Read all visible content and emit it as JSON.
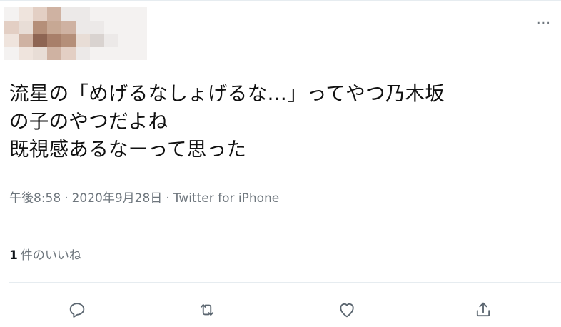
{
  "header": {
    "more_label": "···"
  },
  "tweet": {
    "text": "流星の「めげるなしょげるな…」ってやつ乃木坂\nの子のやつだよね\n既視感あるなーって思った",
    "time": "午後8:58",
    "separator": "·",
    "date": "2020年9月28日",
    "source": "Twitter for iPhone"
  },
  "stats": {
    "likes_count": "1",
    "likes_label": "件のいいね"
  },
  "actions": {
    "reply_icon": "reply-icon",
    "retweet_icon": "retweet-icon",
    "like_icon": "heart-icon",
    "share_icon": "share-icon"
  },
  "colors": {
    "text": "#111111",
    "secondary": "#6e767d",
    "divider": "#e6ecf0",
    "icon": "#5b6670"
  }
}
